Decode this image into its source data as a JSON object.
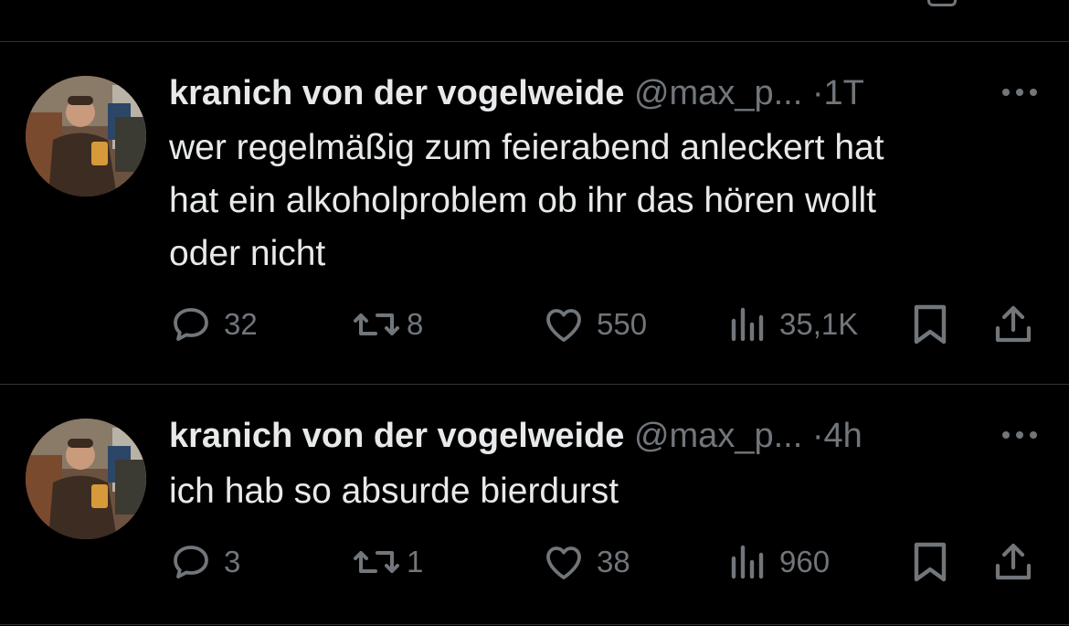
{
  "tweets": [
    {
      "name": "kranich von der vogelweide",
      "handle": "@max_p...",
      "separator": "·",
      "time": "1T",
      "text_lines": [
        "wer regelmäßig zum feierabend anleckert hat",
        "hat ein alkoholproblem ob ihr das hören wollt",
        "oder nicht"
      ],
      "replies": "32",
      "retweets": "8",
      "likes": "550",
      "views": "35,1K"
    },
    {
      "name": "kranich von der vogelweide",
      "handle": "@max_p...",
      "separator": "·",
      "time": "4h",
      "text_lines": [
        "ich hab so absurde bierdurst"
      ],
      "replies": "3",
      "retweets": "1",
      "likes": "38",
      "views": "960"
    }
  ],
  "icons": {
    "reply": "speech-bubble-icon",
    "retweet": "retweet-icon",
    "like": "heart-icon",
    "views": "bar-chart-icon",
    "bookmark": "bookmark-icon",
    "share": "share-upload-icon",
    "more": "more-dots-icon"
  },
  "colors": {
    "background": "#000000",
    "text": "#e7e9ea",
    "muted": "#71767b",
    "divider": "#2f3336"
  }
}
